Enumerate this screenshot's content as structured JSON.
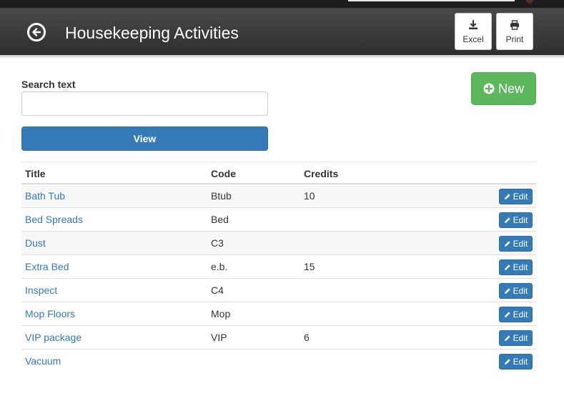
{
  "header": {
    "title": "Housekeeping Activities",
    "back_icon": "circle-arrow-left-icon",
    "buttons": [
      {
        "label": "Excel",
        "icon": "download-icon"
      },
      {
        "label": "Print",
        "icon": "print-icon"
      }
    ]
  },
  "search": {
    "label": "Search text",
    "value": "",
    "placeholder": ""
  },
  "view_button": {
    "label": "View"
  },
  "new_button": {
    "label": "New",
    "icon": "plus-circle-icon"
  },
  "colors": {
    "header": "#3a3a3a",
    "primary": "#337ab7",
    "success": "#5cb85c",
    "link": "#337ab7"
  },
  "table": {
    "columns": [
      "Title",
      "Code",
      "Credits"
    ],
    "edit_label": "Edit",
    "edit_icon": "pencil-icon",
    "rows": [
      {
        "title": "Bath Tub",
        "code": "Btub",
        "credits": "10"
      },
      {
        "title": "Bed Spreads",
        "code": "Bed",
        "credits": ""
      },
      {
        "title": "Dust",
        "code": "C3",
        "credits": ""
      },
      {
        "title": "Extra Bed",
        "code": "e.b.",
        "credits": "15"
      },
      {
        "title": "Inspect",
        "code": "C4",
        "credits": ""
      },
      {
        "title": "Mop Floors",
        "code": "Mop",
        "credits": ""
      },
      {
        "title": "VIP package",
        "code": "VIP",
        "credits": "6"
      },
      {
        "title": "Vacuum",
        "code": "",
        "credits": ""
      }
    ]
  }
}
